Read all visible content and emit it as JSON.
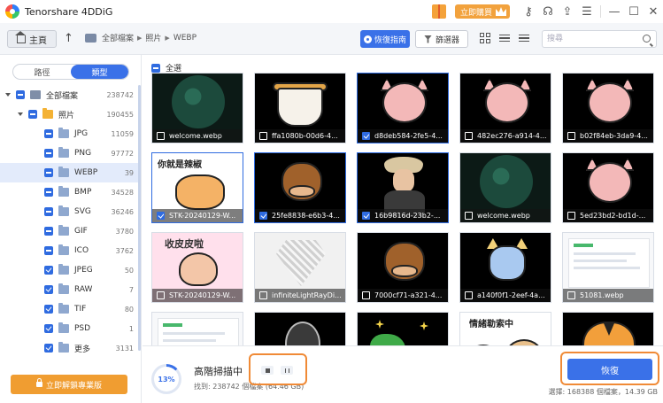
{
  "app": {
    "title": "Tenorshare 4DDiG",
    "buy_label": "立即購買"
  },
  "toolbar": {
    "home_label": "主頁",
    "breadcrumb": [
      "全部檔案",
      "照片",
      "WEBP"
    ],
    "guide_label": "恢復指南",
    "filter_label": "篩選器",
    "search_placeholder": "搜尋"
  },
  "sidebar": {
    "tabs": [
      "路徑",
      "類型"
    ],
    "active_tab": "類型",
    "tree": [
      {
        "label": "全部檔案",
        "count": "238742",
        "level": 0
      },
      {
        "label": "照片",
        "count": "190455",
        "level": 1
      },
      {
        "label": "JPG",
        "count": "11059",
        "level": 2
      },
      {
        "label": "PNG",
        "count": "97772",
        "level": 2
      },
      {
        "label": "WEBP",
        "count": "39",
        "level": 2
      },
      {
        "label": "BMP",
        "count": "34528",
        "level": 2
      },
      {
        "label": "SVG",
        "count": "36246",
        "level": 2
      },
      {
        "label": "GIF",
        "count": "3780",
        "level": 2
      },
      {
        "label": "ICO",
        "count": "3762",
        "level": 2
      },
      {
        "label": "JPEG",
        "count": "50",
        "level": 2
      },
      {
        "label": "RAW",
        "count": "7",
        "level": 2
      },
      {
        "label": "TIF",
        "count": "80",
        "level": 2
      },
      {
        "label": "PSD",
        "count": "1",
        "level": 2
      },
      {
        "label": "更多",
        "count": "3131",
        "level": 2
      }
    ],
    "pro_label": "立即解鎖專業版"
  },
  "main": {
    "select_all_label": "全選",
    "files": [
      {
        "name": "welcome.webp",
        "checked": false
      },
      {
        "name": "ffa1080b-00d6-4...",
        "checked": false
      },
      {
        "name": "d8deb584-2fe5-4...",
        "checked": true
      },
      {
        "name": "482ec276-a914-4...",
        "checked": false
      },
      {
        "name": "b02f84eb-3da9-4...",
        "checked": false
      },
      {
        "name": "STK-20240129-W...",
        "checked": true
      },
      {
        "name": "25fe8838-e6b3-4...",
        "checked": true
      },
      {
        "name": "16b9816d-23b2-...",
        "checked": true
      },
      {
        "name": "welcome.webp",
        "checked": false
      },
      {
        "name": "5ed23bd2-bd1d-...",
        "checked": false
      },
      {
        "name": "STK-20240129-W...",
        "checked": false
      },
      {
        "name": "infiniteLightRayDi...",
        "checked": false
      },
      {
        "name": "7000cf71-a321-4...",
        "checked": false
      },
      {
        "name": "a140f0f1-2eef-4a...",
        "checked": false
      },
      {
        "name": "51081.webp",
        "checked": false
      }
    ],
    "tile_text": {
      "cat": "你就是辣椒",
      "pink": "收皮皮啦",
      "bear": "情緒勒索中"
    }
  },
  "scan": {
    "percent": "13%",
    "progress": 0.13,
    "title": "高階掃描中",
    "found": "找到: 238742 個檔案 (64.46 GB)"
  },
  "recover_label": "恢復",
  "selected_info": "選擇: 168388 個檔案，14.39 GB",
  "colors": {
    "accent": "#3a71e8",
    "highlight": "#f08a36",
    "pro": "#f09d31"
  }
}
